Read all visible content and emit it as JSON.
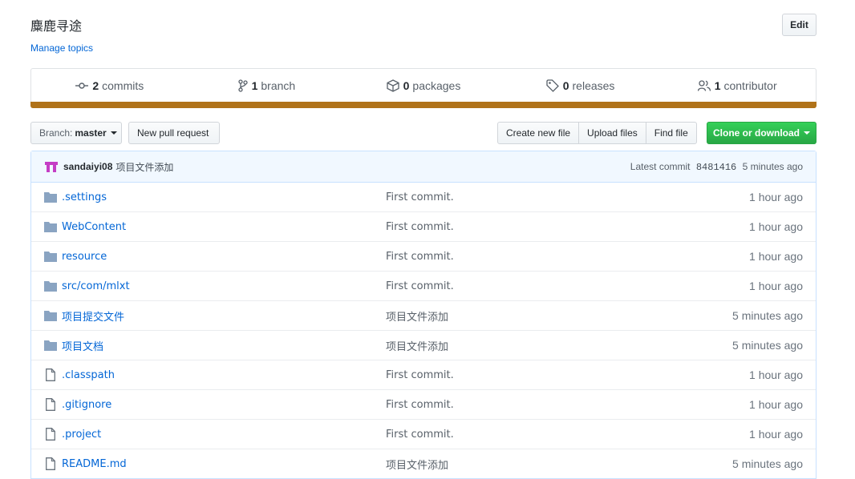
{
  "repo": {
    "description": "麋鹿寻途",
    "manage_topics": "Manage topics",
    "edit_label": "Edit"
  },
  "numbers": [
    {
      "count": "2",
      "label": "commits",
      "icon": "commit-icon"
    },
    {
      "count": "1",
      "label": "branch",
      "icon": "branch-icon"
    },
    {
      "count": "0",
      "label": "packages",
      "icon": "package-icon"
    },
    {
      "count": "0",
      "label": "releases",
      "icon": "tag-icon"
    },
    {
      "count": "1",
      "label": "contributor",
      "icon": "people-icon"
    }
  ],
  "language_color": "#b07219",
  "toolbar": {
    "branch_label": "Branch:",
    "branch_value": "master",
    "new_pr": "New pull request",
    "create_file": "Create new file",
    "upload_files": "Upload files",
    "find_file": "Find file",
    "clone": "Clone or download"
  },
  "latest_commit": {
    "author": "sandaiyi08",
    "message": "项目文件添加",
    "label": "Latest commit",
    "sha": "8481416",
    "age": "5 minutes ago"
  },
  "files": [
    {
      "name": ".settings",
      "type": "dir",
      "message": "First commit.",
      "age": "1 hour ago"
    },
    {
      "name": "WebContent",
      "type": "dir",
      "message": "First commit.",
      "age": "1 hour ago"
    },
    {
      "name": "resource",
      "type": "dir",
      "message": "First commit.",
      "age": "1 hour ago"
    },
    {
      "name": "src/com/mlxt",
      "type": "dir",
      "message": "First commit.",
      "age": "1 hour ago"
    },
    {
      "name": "项目提交文件",
      "type": "dir",
      "message": "项目文件添加",
      "age": "5 minutes ago"
    },
    {
      "name": "项目文档",
      "type": "dir",
      "message": "项目文件添加",
      "age": "5 minutes ago"
    },
    {
      "name": ".classpath",
      "type": "file",
      "message": "First commit.",
      "age": "1 hour ago"
    },
    {
      "name": ".gitignore",
      "type": "file",
      "message": "First commit.",
      "age": "1 hour ago"
    },
    {
      "name": ".project",
      "type": "file",
      "message": "First commit.",
      "age": "1 hour ago"
    },
    {
      "name": "README.md",
      "type": "file",
      "message": "项目文件添加",
      "age": "5 minutes ago"
    }
  ]
}
